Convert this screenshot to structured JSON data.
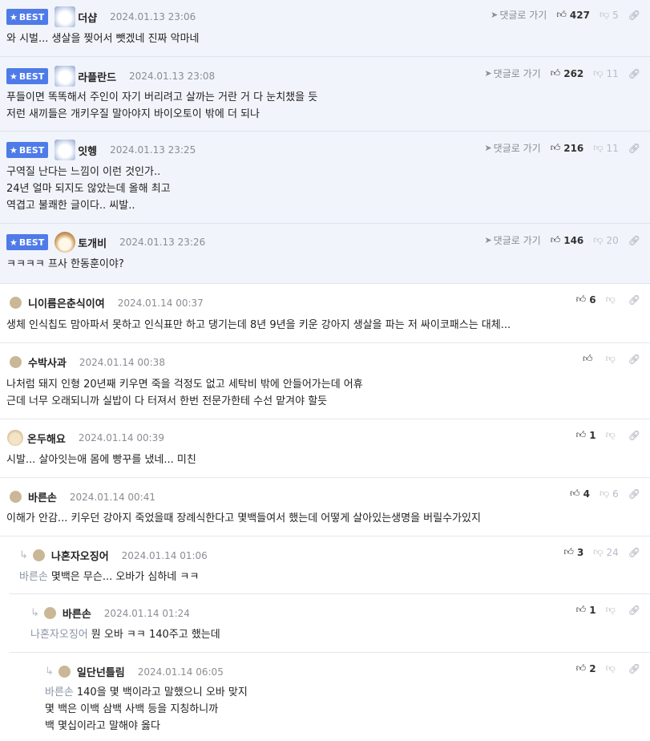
{
  "best_badge": "BEST",
  "goto_label": "댓글로 가기",
  "comments": [
    {
      "nick": "더샵",
      "date": "2024.01.13 23:06",
      "up": "427",
      "down": "5",
      "lines": [
        "와 시벌... 생살을 찢어서 뺏겠네 진짜 악마네"
      ]
    },
    {
      "nick": "라플란드",
      "date": "2024.01.13 23:08",
      "up": "262",
      "down": "11",
      "lines": [
        "푸들이면 똑똑해서 주인이 자기 버리려고 살까는 거란 거 다 눈치챘을 듯",
        "저런 새끼들은 개키우질 말아야지 바이오토이 밖에 더 되나"
      ]
    },
    {
      "nick": "잇헹",
      "date": "2024.01.13 23:25",
      "up": "216",
      "down": "11",
      "lines": [
        "구역질 난다는 느낌이 이런 것인가..",
        "24년 얼마 되지도 않았는데 올해 최고",
        "역겹고 불쾌한 글이다.. 씨발.."
      ]
    },
    {
      "nick": "토개비",
      "date": "2024.01.13 23:26",
      "up": "146",
      "down": "20",
      "lines": [
        "ㅋㅋㅋㅋ 프사 한동훈이야?"
      ]
    },
    {
      "nick": "니이름은춘식이여",
      "date": "2024.01.14 00:37",
      "up": "6",
      "down": "",
      "lines": [
        "생체 인식칩도 맘아파서 못하고 인식표만 하고 댕기는데 8년 9년을 키운 강아지 생살을 파는 저 싸이코패스는 대체..."
      ]
    },
    {
      "nick": "수박사과",
      "date": "2024.01.14 00:38",
      "up": "",
      "down": "",
      "lines": [
        "나처럼 돼지 인형 20년째 키우면 죽을 걱정도 없고 세탁비 밖에 안들어가는데 어휴",
        "근데 너무 오래되니까 실밥이 다 터져서 한번 전문가한테 수선 맡겨야 할듯"
      ]
    },
    {
      "nick": "온두해요",
      "date": "2024.01.14 00:39",
      "up": "1",
      "down": "",
      "lines": [
        "시발... 살아잇는애 몸에 빵꾸를 냈네... 미친"
      ]
    },
    {
      "nick": "바른손",
      "date": "2024.01.14 00:41",
      "up": "4",
      "down": "6",
      "lines": [
        "이해가 안감... 키우던 강아지 죽었을때 장례식한다고 몇백들여서 했는데 어떻게 살아있는생명을 버릴수가있지"
      ]
    },
    {
      "nick": "나혼자오징어",
      "date": "2024.01.14 01:06",
      "up": "3",
      "down": "24",
      "mention": "바른손",
      "lines": [
        "몇백은 무슨... 오바가 심하네 ㅋㅋ"
      ]
    },
    {
      "nick": "바른손",
      "date": "2024.01.14 01:24",
      "up": "1",
      "down": "",
      "mention": "나혼자오징어",
      "lines": [
        "뭔 오바 ㅋㅋ 140주고 했는데"
      ]
    },
    {
      "nick": "일단넌틀림",
      "date": "2024.01.14 06:05",
      "up": "2",
      "down": "",
      "mention": "바른손",
      "lines": [
        "140을 몇 백이라고 말했으니 오바 맞지",
        "몇 백은 이백 삼백 사백 등을 지칭하니까",
        "백 몇십이라고 말해야 옳다"
      ]
    }
  ]
}
